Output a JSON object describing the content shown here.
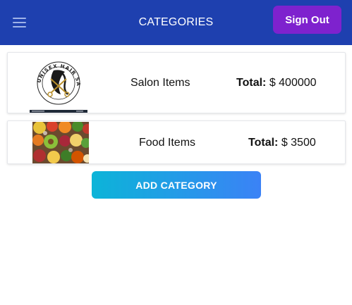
{
  "header": {
    "title": "CATEGORIES",
    "menu_icon": "hamburger-menu-icon",
    "signout_label": "Sign Out",
    "background_color": "#1e40af",
    "signout_color": "#7e22ce"
  },
  "categories": [
    {
      "name": "Salon Items",
      "total_label": "Total:",
      "total_value": "$ 400000",
      "image": "salon-logo-image",
      "logo_text": "UNISEX HAIR SALON"
    },
    {
      "name": "Food Items",
      "total_label": "Total:",
      "total_value": "$ 3500",
      "image": "food-photo-image"
    }
  ],
  "actions": {
    "add_category_label": "ADD CATEGORY",
    "gradient_start": "#0cb4d8",
    "gradient_end": "#3b82f6"
  }
}
